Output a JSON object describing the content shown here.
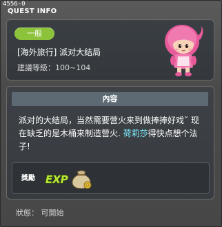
{
  "window": {
    "id_label": "4556-0",
    "title": "QUEST INFO"
  },
  "quest": {
    "category_badge": "一般",
    "name": "[海外旅行] 派对大结局",
    "level_requirement": "建議等級：100~104",
    "npc_icon": "pink-hooded-girl-npc-icon"
  },
  "content": {
    "header": "內容",
    "description_before": "派对的大结局，当然需要营火来到做捧捧好戏˜ 现在缺乏的是木桶来制造营火. ",
    "npc_name": "荷莉莎",
    "description_after": "得快点想个法子!"
  },
  "reward": {
    "label": "獎勵",
    "exp_icon": "exp-icon",
    "item_icon": "money-bag-icon"
  },
  "status": {
    "text": "狀態： 可開始"
  },
  "colors": {
    "badge": "#8cc33b",
    "highlight": "#7ff0ff",
    "header_bar": "#5d6a74"
  }
}
